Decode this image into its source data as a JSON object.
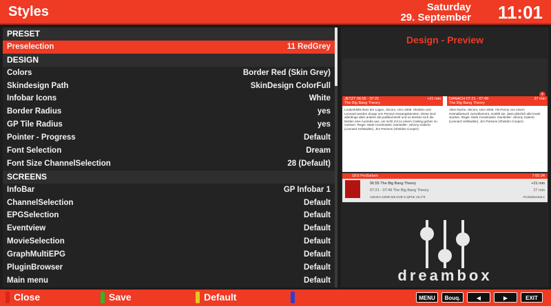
{
  "header": {
    "title": "Styles",
    "day": "Saturday",
    "date": "29. September",
    "time": "11:01"
  },
  "list": [
    {
      "type": "section",
      "label": "PRESET"
    },
    {
      "type": "item",
      "label": "Preselection",
      "value": "11 RedGrey",
      "selected": true
    },
    {
      "type": "section",
      "label": "DESIGN"
    },
    {
      "type": "item",
      "label": "Colors",
      "value": "Border Red (Skin Grey)"
    },
    {
      "type": "item",
      "label": "Skindesign Path",
      "value": "SkinDesign ColorFull"
    },
    {
      "type": "item",
      "label": "Infobar Icons",
      "value": "White"
    },
    {
      "type": "item",
      "label": "Border Radius",
      "value": "yes"
    },
    {
      "type": "item",
      "label": "GP Tile Radius",
      "value": "yes"
    },
    {
      "type": "item",
      "label": "Pointer - Progress",
      "value": "Default"
    },
    {
      "type": "item",
      "label": "Font Selection",
      "value": "Dream"
    },
    {
      "type": "item",
      "label": "Font Size ChannelSelection",
      "value": "28 (Default)"
    },
    {
      "type": "section",
      "label": "SCREENS"
    },
    {
      "type": "item",
      "label": "InfoBar",
      "value": "GP Infobar 1"
    },
    {
      "type": "item",
      "label": "ChannelSelection",
      "value": "Default"
    },
    {
      "type": "item",
      "label": "EPGSelection",
      "value": "Default"
    },
    {
      "type": "item",
      "label": "Eventview",
      "value": "Default"
    },
    {
      "type": "item",
      "label": "MovieSelection",
      "value": "Default"
    },
    {
      "type": "item",
      "label": "GraphMultiEPG",
      "value": "Default"
    },
    {
      "type": "item",
      "label": "PluginBrowser",
      "value": "Default"
    },
    {
      "type": "item",
      "label": "Main menu",
      "value": "Default"
    }
  ],
  "scroll": {
    "position": 0
  },
  "preview": {
    "title": "Design - Preview",
    "now_bar": "JETZT     06:55 - 07:21",
    "now_mins": "+21 min",
    "now_show": "The Big Bang Theory",
    "next_bar": "DANACH     07:21 - 07:49",
    "next_mins": "27 min",
    "next_show": "The Big Bang Theory",
    "now_text": "Looberkfalls Netz der Lügen, Sitcom, USA 2008. Sheldon und Leonard werden Zeuge von Pennys Gesangskünsten. Diese sind allerdings alles andere als publikumsreif und so denken sich die beiden eine Ausrede aus, um nicht mit zu einem Casting gehen zu müssen. Regie: Mark Cendrowski. Darsteller: Johnny Galecki (Leonard Hofstadter), Jim Parsons (Sheldon Cooper)",
    "next_text": "Alles Rache, Sitcom, USA 2008. Als Penny von einem Heimatbesuch zurückkommt, erzählt sie, dass plötzlich alle krank wurden. Regie: Mark Cendrowski. Darsteller: Johnny Galecki (Leonard Hofstadter), Jim Parsons (Sheldon Cooper)",
    "channel": "18:5   ProSieben",
    "channel_time": "7:00:34",
    "p_now": "06:55   The Big Bang Theory",
    "p_now_r": "+21 min",
    "p_next": "07:21 - 07:49   The Big Bang Theory",
    "p_next_r": "27 min",
    "p_tech": "12544H  22000  5/6  DVB-S  QPSK  19.2°E",
    "p_tech_r": "ProSiebenSat.1",
    "brand": "dreambox"
  },
  "footer": {
    "red": "Close",
    "green": "Save",
    "yellow": "Default",
    "blue": "",
    "menu": "MENU",
    "bouq": "Bouq.",
    "prev": "◀",
    "next": "▶",
    "exit": "EXIT",
    "colors": {
      "red": "#d8261a",
      "green": "#2db82d",
      "yellow": "#e6c81c",
      "blue": "#2a3fd6"
    }
  }
}
